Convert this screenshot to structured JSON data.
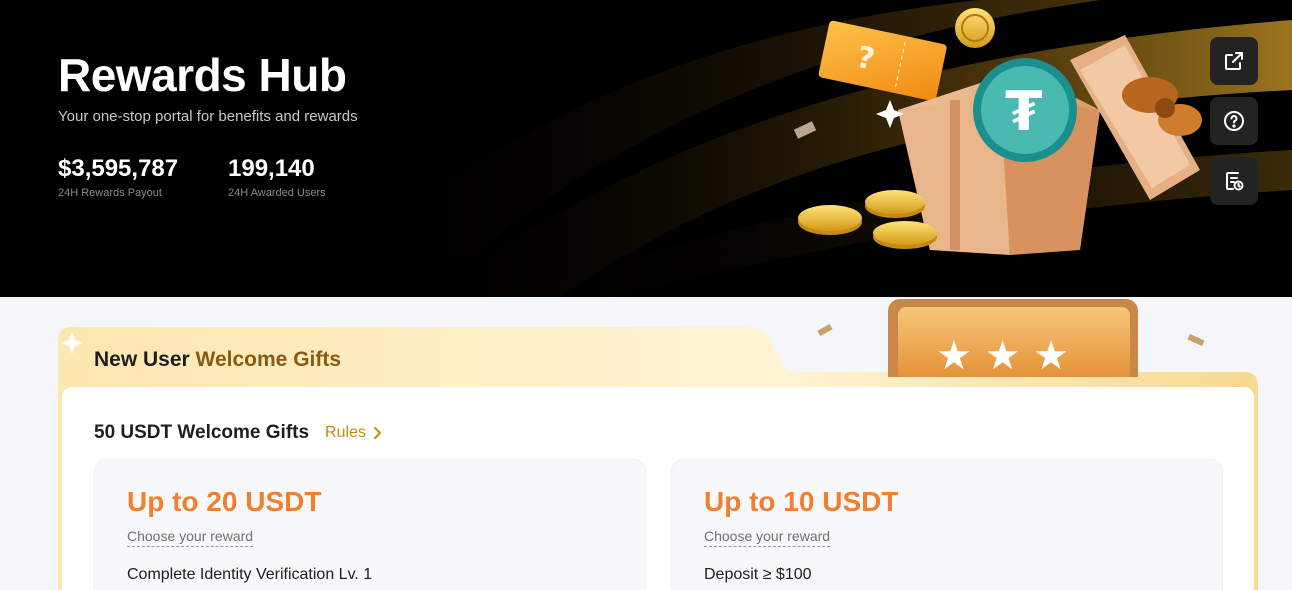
{
  "hero": {
    "title": "Rewards Hub",
    "subtitle": "Your one-stop portal for benefits and rewards",
    "stats": [
      {
        "value": "$3,595,787",
        "label": "24H Rewards Payout"
      },
      {
        "value": "199,140",
        "label": "24H Awarded Users"
      }
    ],
    "side_buttons": [
      {
        "icon": "external-link-icon"
      },
      {
        "icon": "help-icon"
      },
      {
        "icon": "history-icon"
      }
    ]
  },
  "welcome": {
    "title_plain": "New User ",
    "title_gold": "Welcome Gifts",
    "heading": "50 USDT Welcome Gifts",
    "rules_label": "Rules",
    "cards": [
      {
        "amount": "Up to 20 USDT",
        "choose": "Choose your reward",
        "task": "Complete Identity Verification Lv. 1"
      },
      {
        "amount": "Up to 10 USDT",
        "choose": "Choose your reward",
        "task": "Deposit ≥ $100"
      }
    ]
  },
  "colors": {
    "accent_orange": "#f07f2e",
    "gold": "#c98a0c",
    "hero_bg": "#000000"
  }
}
